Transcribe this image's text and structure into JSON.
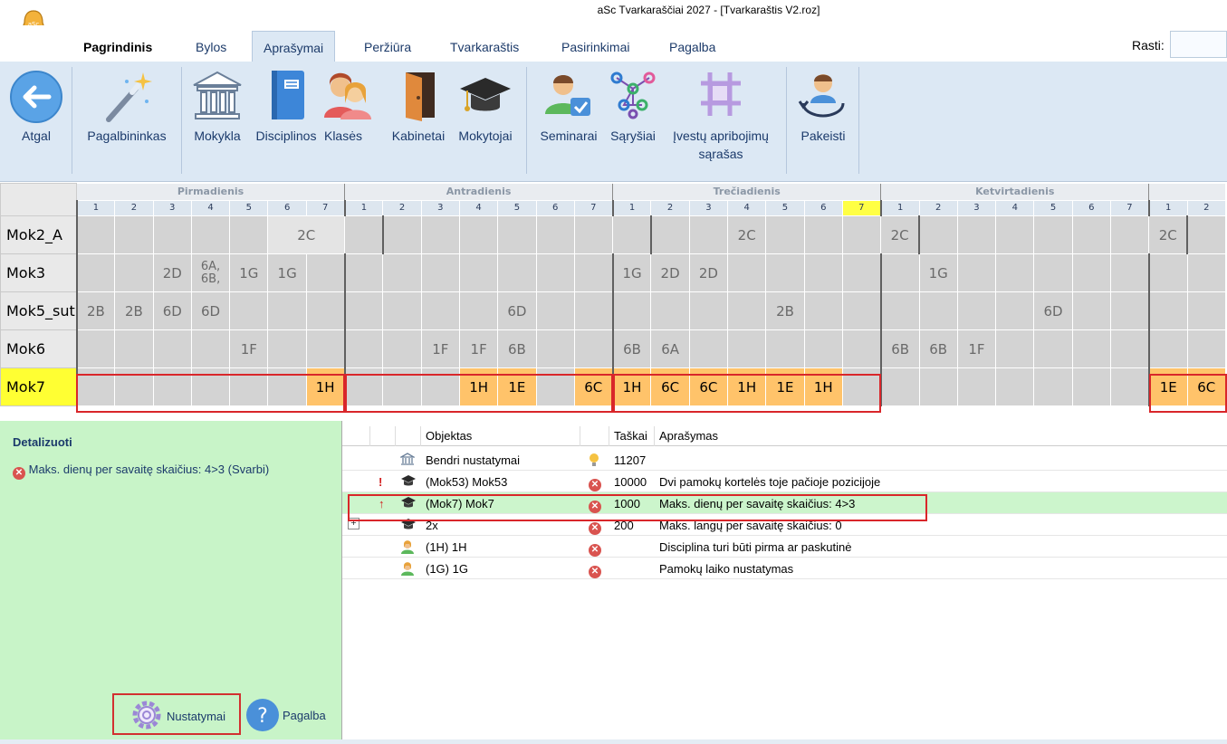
{
  "window": {
    "title": "aSc Tvarkaraščiai 2027  - [Tvarkaraštis V2.roz]"
  },
  "menu": {
    "tabs": [
      "Pagrindinis",
      "Bylos",
      "Aprašymai",
      "Peržiūra",
      "Tvarkaraštis",
      "Pasirinkimai",
      "Pagalba"
    ],
    "active": "Aprašymai",
    "search_label": "Rasti:"
  },
  "ribbon": {
    "back": "Atgal",
    "wizard": "Pagalbininkas",
    "school": "Mokykla",
    "subjects": "Disciplinos",
    "classes": "Klasės",
    "rooms": "Kabinetai",
    "teachers": "Mokytojai",
    "seminars": "Seminarai",
    "relations": "Sąryšiai",
    "constraints_line1": "Įvestų apribojimų",
    "constraints_line2": "sąrašas",
    "replace": "Pakeisti"
  },
  "grid": {
    "days": [
      "Pirmadienis",
      "Antradienis",
      "Trečiadienis",
      "Ketvirtadienis"
    ],
    "periods": [
      "1",
      "2",
      "3",
      "4",
      "5",
      "6",
      "7"
    ],
    "last_day_periods": [
      "1",
      "2"
    ],
    "highlight": {
      "day": 2,
      "period": 6
    },
    "rows": [
      {
        "name": "Mok2_A",
        "cells": [
          "",
          "",
          "",
          "",
          "",
          "2C",
          "",
          "",
          "",
          "",
          "",
          "",
          "",
          "",
          "",
          "",
          "",
          "2C",
          "",
          "",
          "",
          "2C",
          "",
          "",
          "",
          "",
          "",
          "",
          "2C",
          ""
        ]
      },
      {
        "name": "Mok3",
        "cells": [
          "",
          "",
          "2D",
          "6A, 6B,",
          "1G",
          "1G",
          "",
          "",
          "",
          "",
          "",
          "",
          "",
          "",
          "1G",
          "2D",
          "2D",
          "",
          "",
          "",
          "",
          "",
          "1G",
          "",
          "",
          "",
          "",
          "",
          "",
          ""
        ]
      },
      {
        "name": "Mok5_sut",
        "cells": [
          "2B",
          "2B",
          "6D",
          "6D",
          "",
          "",
          "",
          "",
          "",
          "",
          "",
          "6D",
          "",
          "",
          "",
          "",
          "",
          "",
          "2B",
          "",
          "",
          "",
          "",
          "",
          "",
          "6D",
          "",
          "",
          "",
          ""
        ]
      },
      {
        "name": "Mok6",
        "cells": [
          "",
          "",
          "",
          "",
          "1F",
          "",
          "",
          "",
          "",
          "1F",
          "1F",
          "6B",
          "",
          "",
          "6B",
          "6A",
          "",
          "",
          "",
          "",
          "",
          "6B",
          "6B",
          "1F",
          "",
          "",
          "",
          "",
          "",
          ""
        ]
      },
      {
        "name": "Mok7",
        "cells": [
          "",
          "",
          "",
          "",
          "",
          "",
          "1H",
          "",
          "",
          "",
          "1H",
          "1E",
          "",
          "6C",
          "1H",
          "6C",
          "6C",
          "1H",
          "1E",
          "1H",
          "",
          "",
          "",
          "",
          "",
          "",
          "",
          "",
          "1E",
          "6C"
        ]
      }
    ]
  },
  "detail": {
    "title": "Detalizuoti",
    "message": "Maks. dienų per savaitę skaičius: 4>3 (Svarbi)",
    "settings": "Nustatymai",
    "help": "Pagalba"
  },
  "list": {
    "headers": {
      "object": "Objektas",
      "points": "Taškai",
      "description": "Aprašymas"
    },
    "rows": [
      {
        "flag": "",
        "icon": "school",
        "object": "Bendri nustatymai",
        "status": "bulb",
        "points": "11207",
        "description": ""
      },
      {
        "flag": "!",
        "icon": "teacher",
        "object": "(Mok53) Mok53",
        "status": "error",
        "points": "10000",
        "description": "Dvi pamokų kortelės toje pačioje pozicijoje"
      },
      {
        "flag": "↑",
        "icon": "teacher",
        "object": "(Mok7) Mok7",
        "status": "error",
        "points": "1000",
        "description": "Maks. dienų per savaitę skaičius: 4>3"
      },
      {
        "flag": "+",
        "icon": "teacher",
        "object": "2x",
        "status": "error",
        "points": "200",
        "description": "Maks. langų per savaitę skaičius: 0"
      },
      {
        "flag": "",
        "icon": "student",
        "object": "(1H) 1H",
        "status": "error",
        "points": "",
        "description": "Disciplina turi būti pirma ar paskutinė"
      },
      {
        "flag": "",
        "icon": "student",
        "object": "(1G) 1G",
        "status": "error",
        "points": "",
        "description": "Pamokų laiko nustatymas"
      }
    ]
  },
  "colors": {
    "ribbon_bg": "#dce8f4",
    "orange_card": "#ffc36a",
    "selected_teacher": "#ffff33",
    "detail_bg": "#c8f4c8",
    "error_red": "#d9534f"
  }
}
